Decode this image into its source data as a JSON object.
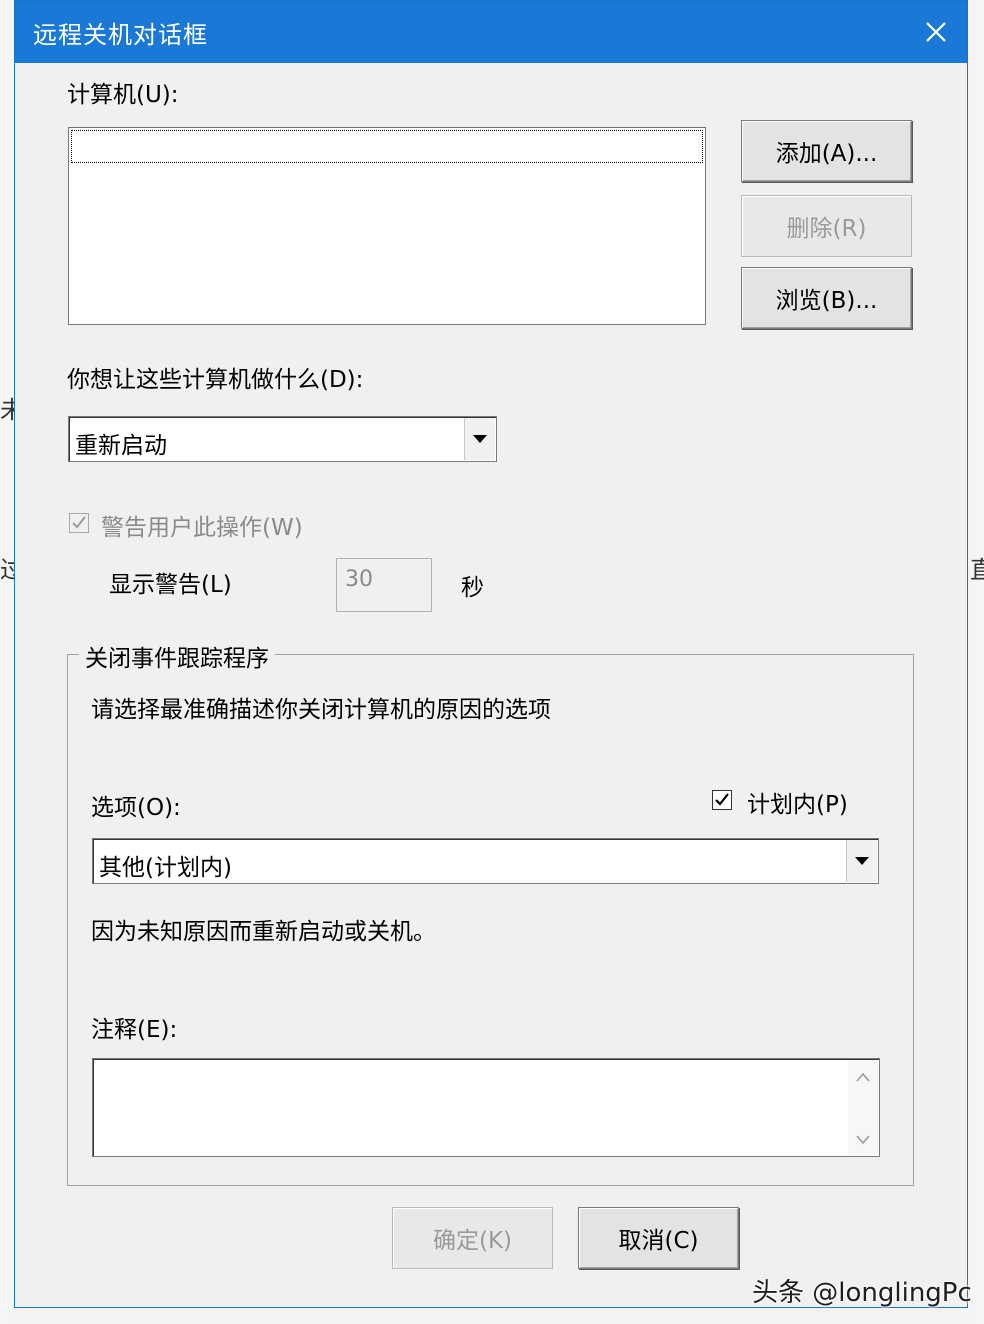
{
  "window": {
    "title": "远程关机对话框"
  },
  "computers": {
    "label": "计算机(U):",
    "items": [],
    "add_button": "添加(A)...",
    "remove_button": "删除(R)",
    "browse_button": "浏览(B)..."
  },
  "action": {
    "label": "你想让这些计算机做什么(D):",
    "selected": "重新启动"
  },
  "warn": {
    "checkbox_label": "警告用户此操作(W)",
    "checked": true,
    "enabled": false,
    "display_label": "显示警告(L)",
    "seconds_value": "30",
    "seconds_unit": "秒"
  },
  "tracker": {
    "group_title": "关闭事件跟踪程序",
    "instruction": "请选择最准确描述你关闭计算机的原因的选项",
    "option_label": "选项(O):",
    "planned_label": "计划内(P)",
    "planned_checked": true,
    "option_selected": "其他(计划内)",
    "description": "因为未知原因而重新启动或关机。",
    "comment_label": "注释(E):",
    "comment_value": ""
  },
  "footer": {
    "ok_button": "确定(K)",
    "cancel_button": "取消(C)"
  },
  "watermark": "头条 @longlingPc",
  "colors": {
    "titlebar": "#1a78d6",
    "dialog_bg": "#f0f0f0",
    "disabled_text": "#8a8a8a"
  }
}
